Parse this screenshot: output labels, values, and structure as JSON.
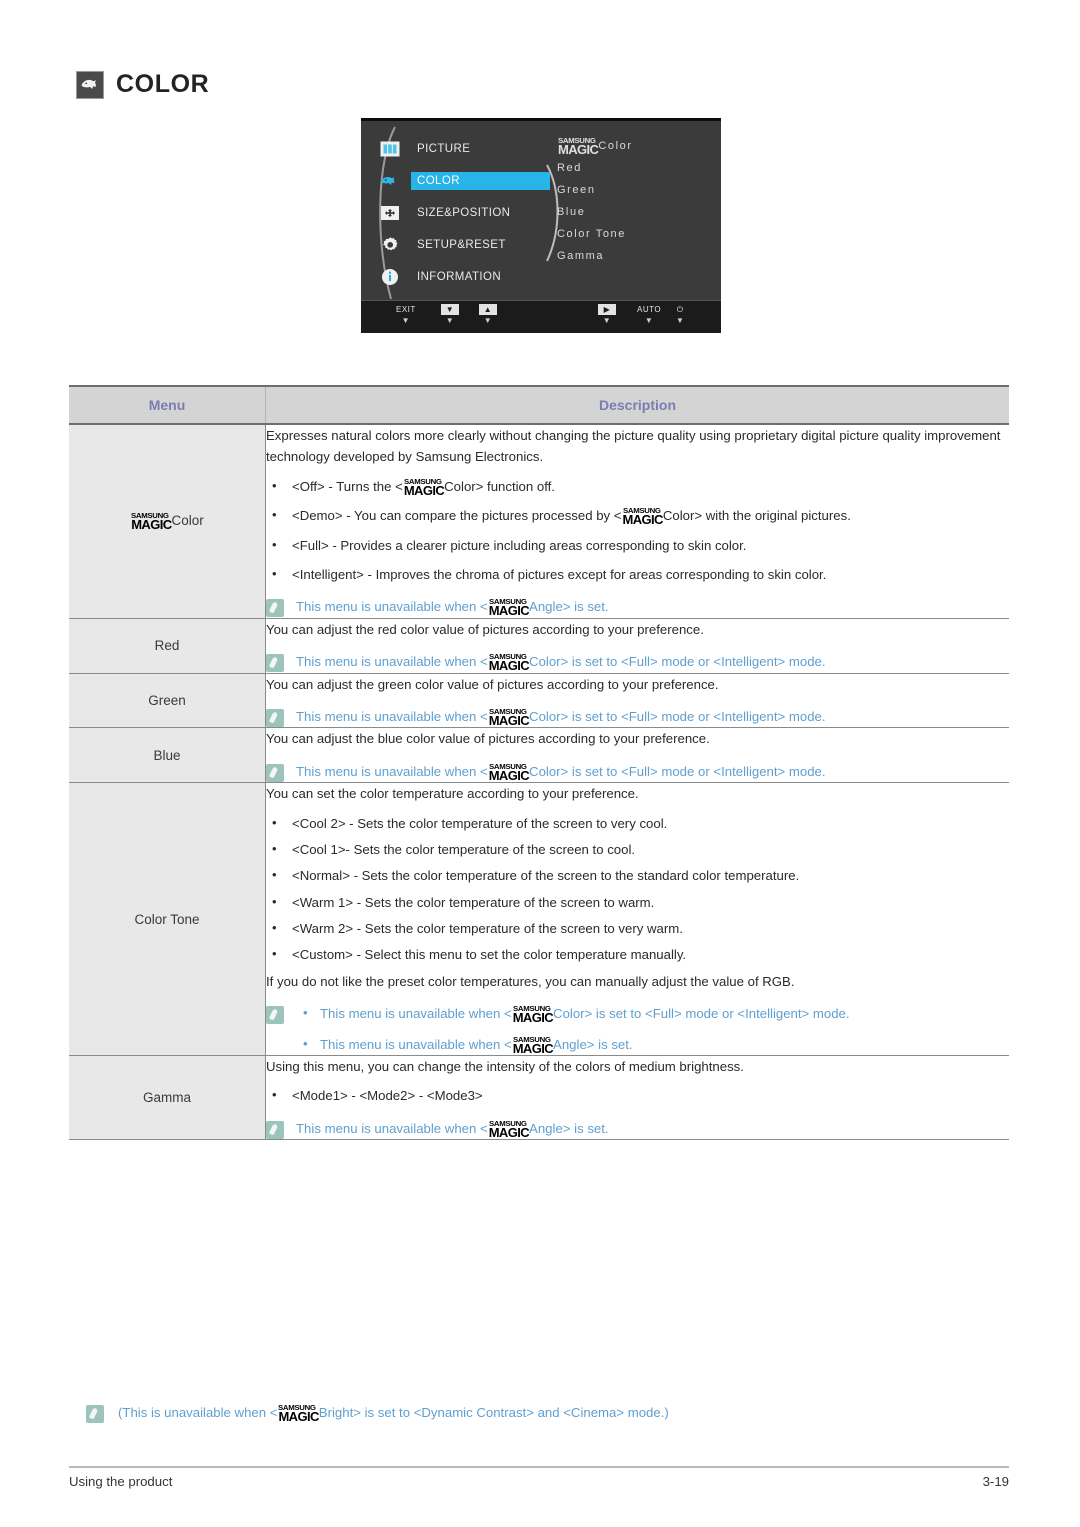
{
  "heading": {
    "icon": "color-dolphin-icon",
    "title": "COLOR"
  },
  "osd": {
    "left_menu": [
      {
        "label": "PICTURE",
        "icon": "picture-bars-icon",
        "active": false
      },
      {
        "label": "COLOR",
        "icon": "color-dolphin-icon",
        "active": true
      },
      {
        "label": "SIZE&POSITION",
        "icon": "size-position-icon",
        "active": false
      },
      {
        "label": "SETUP&RESET",
        "icon": "gear-icon",
        "active": false
      },
      {
        "label": "INFORMATION",
        "icon": "info-icon",
        "active": false
      }
    ],
    "right_menu": [
      {
        "prefix_logo": true,
        "label": "Color"
      },
      {
        "prefix_logo": false,
        "label": "Red"
      },
      {
        "prefix_logo": false,
        "label": "Green"
      },
      {
        "prefix_logo": false,
        "label": "Blue"
      },
      {
        "prefix_logo": false,
        "label": "Color Tone"
      },
      {
        "prefix_logo": false,
        "label": "Gamma"
      }
    ],
    "buttons": [
      {
        "name": "exit-button",
        "type": "text",
        "label": "EXIT"
      },
      {
        "name": "down-button",
        "type": "glyph",
        "label": "▼"
      },
      {
        "name": "up-button",
        "type": "glyph",
        "label": "▲"
      },
      {
        "name": "enter-button",
        "type": "glyph",
        "label": "▶"
      },
      {
        "name": "auto-button",
        "type": "text",
        "label": "AUTO"
      },
      {
        "name": "power-button",
        "type": "text",
        "label": "⏻"
      }
    ],
    "caret": "▼",
    "highlight_color": "#27b4e8"
  },
  "logo": {
    "top": "SAMSUNG",
    "bottom": "MAGIC"
  },
  "table": {
    "headers": {
      "menu": "Menu",
      "description": "Description"
    },
    "rows": [
      {
        "menu_logo": true,
        "menu": "Color",
        "intro": "Expresses natural colors more clearly without changing the picture quality using proprietary digital picture quality improvement technology developed by Samsung Electronics.",
        "bullets": [
          {
            "pre": "<Off> - Turns the <",
            "logo": true,
            "post": "Color> function off."
          },
          {
            "pre": "<Demo> - You can compare the pictures processed by <",
            "logo": true,
            "post": "Color> with the original pictures."
          },
          {
            "pre": "<Full> - Provides a clearer picture including areas corresponding to skin color.",
            "logo": false,
            "post": ""
          },
          {
            "pre": "<Intelligent> - Improves the chroma of pictures except for areas corresponding to skin color.",
            "logo": false,
            "post": ""
          }
        ],
        "note": {
          "pre": "This menu is unavailable when <",
          "logo": true,
          "post": "Angle> is set."
        }
      },
      {
        "menu_logo": false,
        "menu": "Red",
        "intro": "You can adjust the red color value of pictures according to your preference.",
        "bullets": [],
        "note": {
          "pre": "This menu is unavailable when <",
          "logo": true,
          "post": "Color> is set to <Full> mode or <Intelligent> mode."
        }
      },
      {
        "menu_logo": false,
        "menu": "Green",
        "intro": "You can adjust the green color value of pictures according to your preference.",
        "bullets": [],
        "note": {
          "pre": "This menu is unavailable when <",
          "logo": true,
          "post": "Color> is set to <Full> mode or <Intelligent> mode."
        }
      },
      {
        "menu_logo": false,
        "menu": "Blue",
        "intro": "You can adjust the blue color value of pictures according to your preference.",
        "bullets": [],
        "note": {
          "pre": "This menu is unavailable when <",
          "logo": true,
          "post": "Color> is set to <Full> mode or <Intelligent> mode."
        }
      },
      {
        "menu_logo": false,
        "menu": "Color Tone",
        "intro": "You can set the color temperature according to your preference.",
        "bullets": [
          {
            "pre": "<Cool 2> - Sets the color temperature of the screen to very cool.",
            "logo": false,
            "post": ""
          },
          {
            "pre": "<Cool 1>- Sets the color temperature of the screen to cool.",
            "logo": false,
            "post": ""
          },
          {
            "pre": "<Normal> - Sets the color temperature of the screen to the standard color temperature.",
            "logo": false,
            "post": ""
          },
          {
            "pre": "<Warm 1> - Sets the color temperature of the screen to warm.",
            "logo": false,
            "post": ""
          },
          {
            "pre": "<Warm 2> - Sets the color temperature of the screen to very warm.",
            "logo": false,
            "post": ""
          },
          {
            "pre": "<Custom> - Select this menu to set the color temperature manually.",
            "logo": false,
            "post": ""
          }
        ],
        "outro": "If you do not like the preset color temperatures, you can manually adjust the value of RGB.",
        "note_list": [
          {
            "pre": "This menu is unavailable when <",
            "logo": true,
            "post": "Color> is set to <Full> mode or <Intelligent> mode."
          },
          {
            "pre": "This menu is unavailable when <",
            "logo": true,
            "post": "Angle> is set."
          }
        ]
      },
      {
        "menu_logo": false,
        "menu": "Gamma",
        "intro": "Using this menu, you can change the intensity of the colors of medium brightness.",
        "bullets": [
          {
            "pre": "<Mode1> - <Mode2> - <Mode3>",
            "logo": false,
            "post": ""
          }
        ],
        "note": {
          "pre": "This menu is unavailable when <",
          "logo": true,
          "post": "Angle> is set."
        }
      }
    ]
  },
  "footnote": {
    "pre": "(This is unavailable when <",
    "logo": true,
    "post": "Bright> is set to <Dynamic Contrast> and <Cinema> mode.)"
  },
  "footer": {
    "left": "Using the product",
    "right": "3-19"
  },
  "colors": {
    "header_text": "#7b7cb0",
    "note_text": "#5f9fd0",
    "note_icon": "#9dc4bb",
    "menu_cell_bg": "#e8e8e8",
    "header_bg": "#d4d4d4"
  }
}
